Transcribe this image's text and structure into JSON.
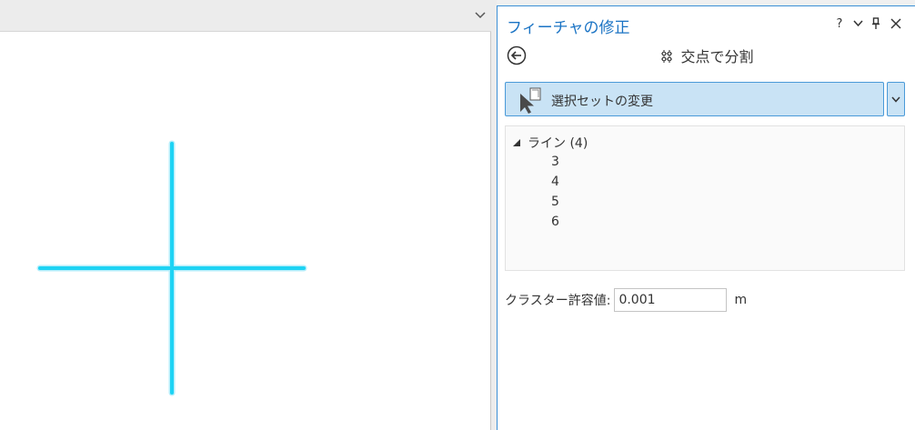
{
  "map": {
    "colors": {
      "line": "#1ed3f4",
      "glow": "#b4eefb"
    }
  },
  "pane": {
    "title": "フィーチャの修正",
    "help_label": "?",
    "tool": {
      "title": "交点で分割"
    },
    "selection": {
      "label": "選択セットの変更"
    },
    "tree": {
      "group_label": "ライン (4)",
      "items": [
        "3",
        "4",
        "5",
        "6"
      ]
    },
    "cluster": {
      "label": "クラスター許容値:",
      "value": "0.001",
      "unit": "m"
    }
  },
  "colors": {
    "accent": "#1a73c4",
    "selection_bg": "#c9e3f5",
    "selection_border": "#4a9ad8"
  }
}
